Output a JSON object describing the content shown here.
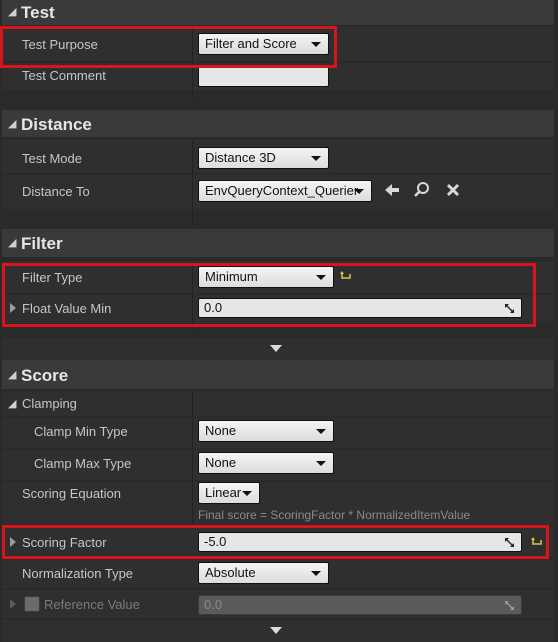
{
  "sections": {
    "test": {
      "title": "Test",
      "test_purpose": {
        "label": "Test Purpose",
        "value": "Filter and Score"
      },
      "test_comment": {
        "label": "Test Comment",
        "value": ""
      }
    },
    "distance": {
      "title": "Distance",
      "test_mode": {
        "label": "Test Mode",
        "value": "Distance 3D"
      },
      "distance_to": {
        "label": "Distance To",
        "value": "EnvQueryContext_Querier"
      }
    },
    "filter": {
      "title": "Filter",
      "filter_type": {
        "label": "Filter Type",
        "value": "Minimum"
      },
      "float_value_min": {
        "label": "Float Value Min",
        "value": "0.0"
      }
    },
    "score": {
      "title": "Score",
      "clamping": {
        "label": "Clamping"
      },
      "clamp_min_type": {
        "label": "Clamp Min Type",
        "value": "None"
      },
      "clamp_max_type": {
        "label": "Clamp Max Type",
        "value": "None"
      },
      "scoring_equation": {
        "label": "Scoring Equation",
        "value": "Linear",
        "hint": "Final score = ScoringFactor * NormalizedItemValue"
      },
      "scoring_factor": {
        "label": "Scoring Factor",
        "value": "-5.0"
      },
      "normalization_type": {
        "label": "Normalization Type",
        "value": "Absolute"
      },
      "reference_value": {
        "label": "Reference Value",
        "value": "0.0"
      }
    }
  },
  "icons": [
    "collapse-arrow-icon",
    "use-selected-arrow-icon",
    "browse-magnifier-icon",
    "clear-x-icon",
    "reset-to-default-icon",
    "resize-drag-icon",
    "expand-chevron-icon"
  ],
  "colors": {
    "highlight": "#d8141c",
    "panel": "#2a2a2a",
    "category": "#3a3a3a"
  }
}
